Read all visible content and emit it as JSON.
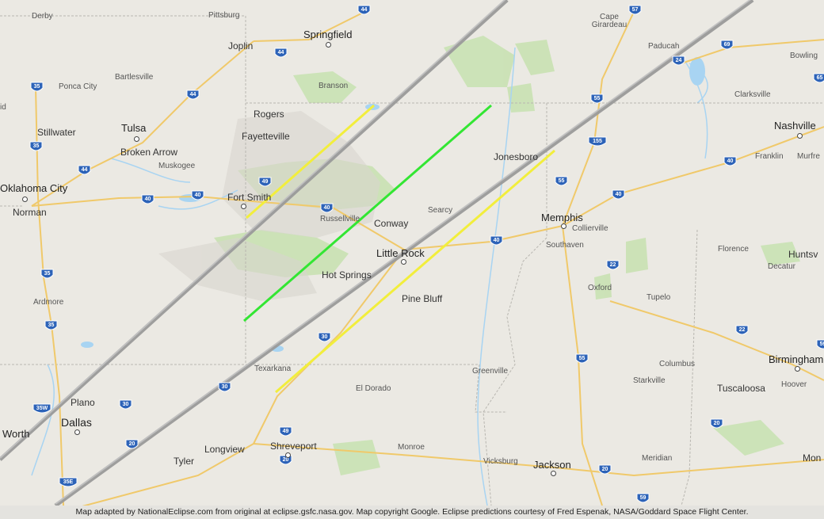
{
  "map": {
    "cities_large": [
      "Springfield",
      "Tulsa",
      "Oklahoma City",
      "Fort Smith",
      "Little Rock",
      "Memphis",
      "Nashville",
      "Dallas",
      "Shreveport",
      "Jackson",
      "Birmingham"
    ],
    "cities_medium": [
      "Joplin",
      "Rogers",
      "Fayetteville",
      "Broken Arrow",
      "Stillwater",
      "Norman",
      "Conway",
      "Hot Springs",
      "Pine Bluff",
      "Jonesboro",
      "Searcy",
      "Texarkana",
      "El Dorado",
      "Longview",
      "Tyler",
      "Plano",
      "Worth",
      "Monroe",
      "Vicksburg",
      "Greenville",
      "Oxford",
      "Tupelo",
      "Columbus",
      "Starkville",
      "Tuscaloosa",
      "Hoover",
      "Meridian",
      "Florence",
      "Decatur",
      "Huntsv",
      "Clarksville",
      "Paducah",
      "Bowling",
      "Franklin",
      "Murfre",
      "Ardmore",
      "Muskogee",
      "Bartlesville",
      "Ponca City",
      "Branson",
      "Russellville",
      "Collierville",
      "Southaven",
      "Cape Girardeau",
      "Pittsburg",
      "Derby",
      "Mon",
      "id"
    ],
    "interstates": [
      "44",
      "57",
      "24",
      "69",
      "65",
      "35",
      "55",
      "155",
      "40",
      "49",
      "22",
      "30",
      "20",
      "59",
      "35E",
      "35W"
    ],
    "path_lines": [
      {
        "name": "northern limit",
        "color": "#f2ee3c"
      },
      {
        "name": "centerline",
        "color": "#33e633"
      },
      {
        "name": "southern limit",
        "color": "#f2ee3c"
      }
    ],
    "colors": {
      "land": "#ebe9e3",
      "water": "#a8d4f2",
      "parks": "#c4dfae",
      "path_edge": "#9a9a9a"
    }
  },
  "credit": "Map adapted by NationalEclipse.com from original at eclipse.gsfc.nasa.gov. Map copyright Google. Eclipse predictions courtesy of Fred Espenak, NASA/Goddard Space Flight Center."
}
